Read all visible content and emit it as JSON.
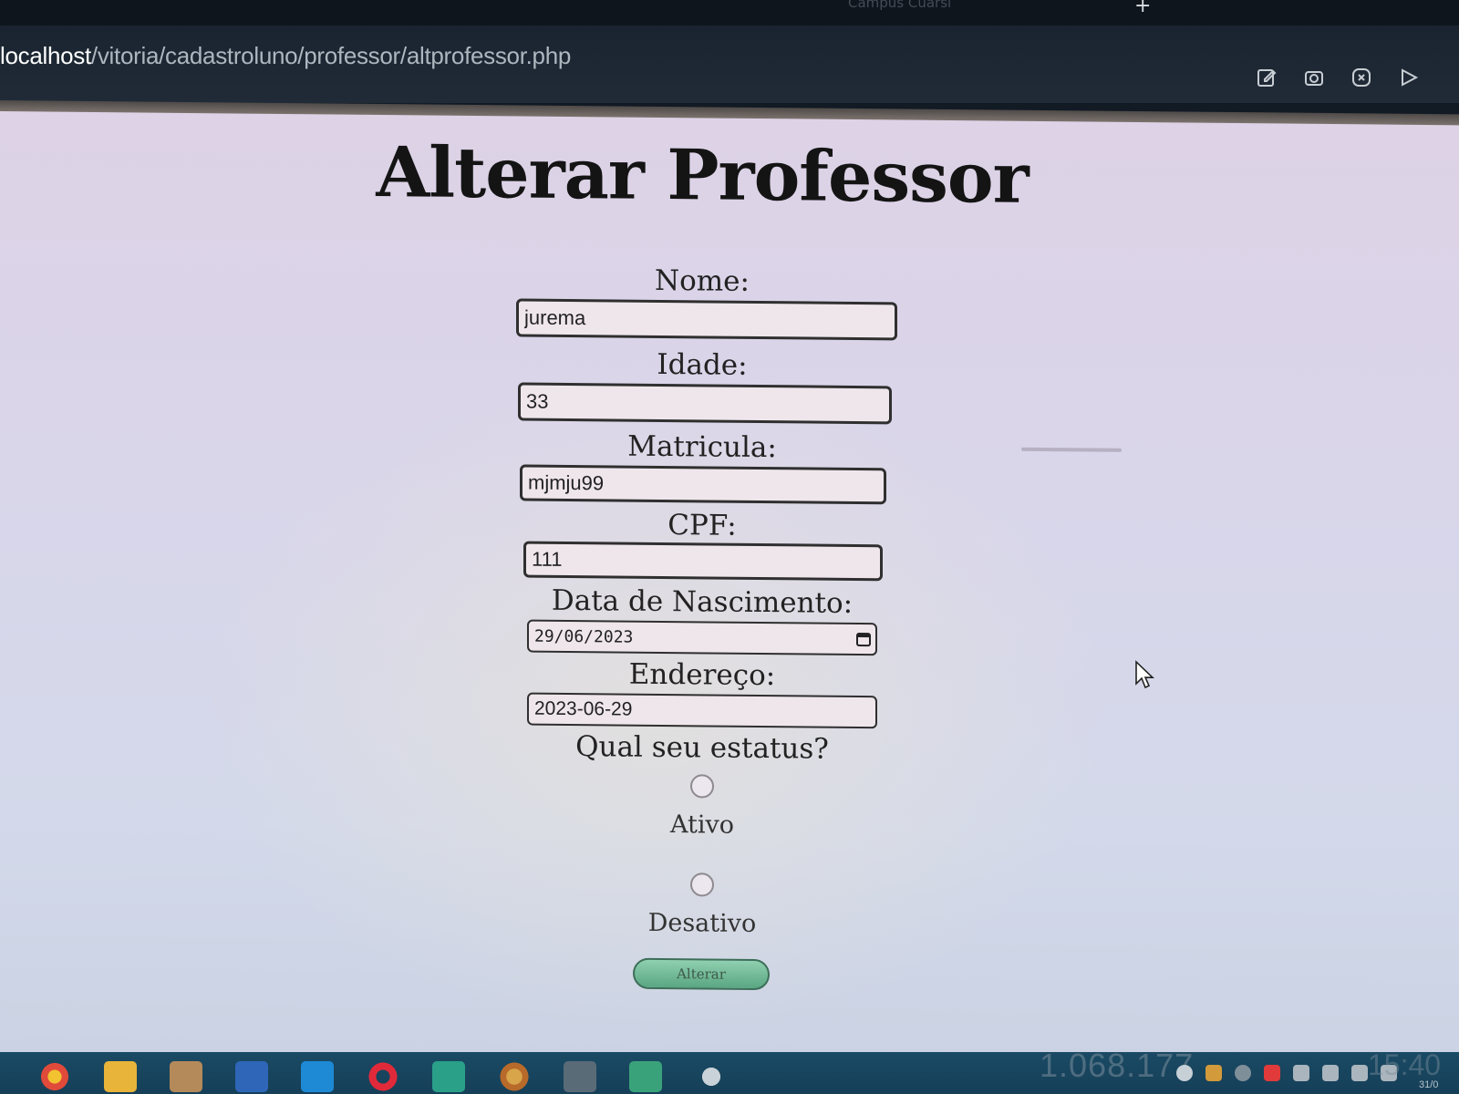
{
  "browser": {
    "url_host": "localhost",
    "url_path": "/vitoria/cadastroluno/professor/altprofessor.php",
    "tab_hint": "Campus Cuarsi",
    "toolbar_icons": [
      "edit-icon",
      "camera-icon",
      "close-circle-icon",
      "play-icon"
    ]
  },
  "page": {
    "title": "Alterar Professor"
  },
  "form": {
    "nome": {
      "label": "Nome:",
      "value": "jurema"
    },
    "idade": {
      "label": "Idade:",
      "value": "33"
    },
    "matricula": {
      "label": "Matricula:",
      "value": "mjmju99"
    },
    "cpf": {
      "label": "CPF:",
      "value": "111"
    },
    "nascimento": {
      "label": "Data de Nascimento:",
      "value": "29/06/2023"
    },
    "endereco": {
      "label": "Endereço:",
      "value": "2023-06-29"
    },
    "status": {
      "question": "Qual seu estatus?",
      "options": [
        {
          "label": "Ativo",
          "checked": false
        },
        {
          "label": "Desativo",
          "checked": false
        }
      ]
    },
    "submit_label": "Alterar"
  },
  "taskbar": {
    "apps": [
      "chrome-icon",
      "folder-icon",
      "app-icon",
      "word-icon",
      "vscode-icon",
      "opera-icon",
      "store-icon",
      "chrome-canary-icon",
      "terminal-icon",
      "maps-icon",
      "settings-icon"
    ],
    "ghost_number": "1.068.177",
    "time": "15:40",
    "date": "31/0"
  },
  "colors": {
    "page_bg": "#d9d6ea",
    "input_bg": "#efe6ec",
    "button": "#6db894",
    "taskbar": "#1a4a64"
  }
}
